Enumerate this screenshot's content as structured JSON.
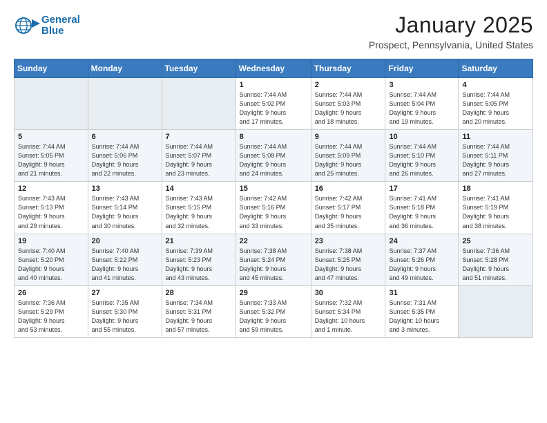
{
  "logo": {
    "line1": "General",
    "line2": "Blue"
  },
  "title": "January 2025",
  "location": "Prospect, Pennsylvania, United States",
  "days_header": [
    "Sunday",
    "Monday",
    "Tuesday",
    "Wednesday",
    "Thursday",
    "Friday",
    "Saturday"
  ],
  "weeks": [
    [
      {
        "day": "",
        "info": ""
      },
      {
        "day": "",
        "info": ""
      },
      {
        "day": "",
        "info": ""
      },
      {
        "day": "1",
        "info": "Sunrise: 7:44 AM\nSunset: 5:02 PM\nDaylight: 9 hours\nand 17 minutes."
      },
      {
        "day": "2",
        "info": "Sunrise: 7:44 AM\nSunset: 5:03 PM\nDaylight: 9 hours\nand 18 minutes."
      },
      {
        "day": "3",
        "info": "Sunrise: 7:44 AM\nSunset: 5:04 PM\nDaylight: 9 hours\nand 19 minutes."
      },
      {
        "day": "4",
        "info": "Sunrise: 7:44 AM\nSunset: 5:05 PM\nDaylight: 9 hours\nand 20 minutes."
      }
    ],
    [
      {
        "day": "5",
        "info": "Sunrise: 7:44 AM\nSunset: 5:05 PM\nDaylight: 9 hours\nand 21 minutes."
      },
      {
        "day": "6",
        "info": "Sunrise: 7:44 AM\nSunset: 5:06 PM\nDaylight: 9 hours\nand 22 minutes."
      },
      {
        "day": "7",
        "info": "Sunrise: 7:44 AM\nSunset: 5:07 PM\nDaylight: 9 hours\nand 23 minutes."
      },
      {
        "day": "8",
        "info": "Sunrise: 7:44 AM\nSunset: 5:08 PM\nDaylight: 9 hours\nand 24 minutes."
      },
      {
        "day": "9",
        "info": "Sunrise: 7:44 AM\nSunset: 5:09 PM\nDaylight: 9 hours\nand 25 minutes."
      },
      {
        "day": "10",
        "info": "Sunrise: 7:44 AM\nSunset: 5:10 PM\nDaylight: 9 hours\nand 26 minutes."
      },
      {
        "day": "11",
        "info": "Sunrise: 7:44 AM\nSunset: 5:11 PM\nDaylight: 9 hours\nand 27 minutes."
      }
    ],
    [
      {
        "day": "12",
        "info": "Sunrise: 7:43 AM\nSunset: 5:13 PM\nDaylight: 9 hours\nand 29 minutes."
      },
      {
        "day": "13",
        "info": "Sunrise: 7:43 AM\nSunset: 5:14 PM\nDaylight: 9 hours\nand 30 minutes."
      },
      {
        "day": "14",
        "info": "Sunrise: 7:43 AM\nSunset: 5:15 PM\nDaylight: 9 hours\nand 32 minutes."
      },
      {
        "day": "15",
        "info": "Sunrise: 7:42 AM\nSunset: 5:16 PM\nDaylight: 9 hours\nand 33 minutes."
      },
      {
        "day": "16",
        "info": "Sunrise: 7:42 AM\nSunset: 5:17 PM\nDaylight: 9 hours\nand 35 minutes."
      },
      {
        "day": "17",
        "info": "Sunrise: 7:41 AM\nSunset: 5:18 PM\nDaylight: 9 hours\nand 36 minutes."
      },
      {
        "day": "18",
        "info": "Sunrise: 7:41 AM\nSunset: 5:19 PM\nDaylight: 9 hours\nand 38 minutes."
      }
    ],
    [
      {
        "day": "19",
        "info": "Sunrise: 7:40 AM\nSunset: 5:20 PM\nDaylight: 9 hours\nand 40 minutes."
      },
      {
        "day": "20",
        "info": "Sunrise: 7:40 AM\nSunset: 5:22 PM\nDaylight: 9 hours\nand 41 minutes."
      },
      {
        "day": "21",
        "info": "Sunrise: 7:39 AM\nSunset: 5:23 PM\nDaylight: 9 hours\nand 43 minutes."
      },
      {
        "day": "22",
        "info": "Sunrise: 7:38 AM\nSunset: 5:24 PM\nDaylight: 9 hours\nand 45 minutes."
      },
      {
        "day": "23",
        "info": "Sunrise: 7:38 AM\nSunset: 5:25 PM\nDaylight: 9 hours\nand 47 minutes."
      },
      {
        "day": "24",
        "info": "Sunrise: 7:37 AM\nSunset: 5:26 PM\nDaylight: 9 hours\nand 49 minutes."
      },
      {
        "day": "25",
        "info": "Sunrise: 7:36 AM\nSunset: 5:28 PM\nDaylight: 9 hours\nand 51 minutes."
      }
    ],
    [
      {
        "day": "26",
        "info": "Sunrise: 7:36 AM\nSunset: 5:29 PM\nDaylight: 9 hours\nand 53 minutes."
      },
      {
        "day": "27",
        "info": "Sunrise: 7:35 AM\nSunset: 5:30 PM\nDaylight: 9 hours\nand 55 minutes."
      },
      {
        "day": "28",
        "info": "Sunrise: 7:34 AM\nSunset: 5:31 PM\nDaylight: 9 hours\nand 57 minutes."
      },
      {
        "day": "29",
        "info": "Sunrise: 7:33 AM\nSunset: 5:32 PM\nDaylight: 9 hours\nand 59 minutes."
      },
      {
        "day": "30",
        "info": "Sunrise: 7:32 AM\nSunset: 5:34 PM\nDaylight: 10 hours\nand 1 minute."
      },
      {
        "day": "31",
        "info": "Sunrise: 7:31 AM\nSunset: 5:35 PM\nDaylight: 10 hours\nand 3 minutes."
      },
      {
        "day": "",
        "info": ""
      }
    ]
  ]
}
